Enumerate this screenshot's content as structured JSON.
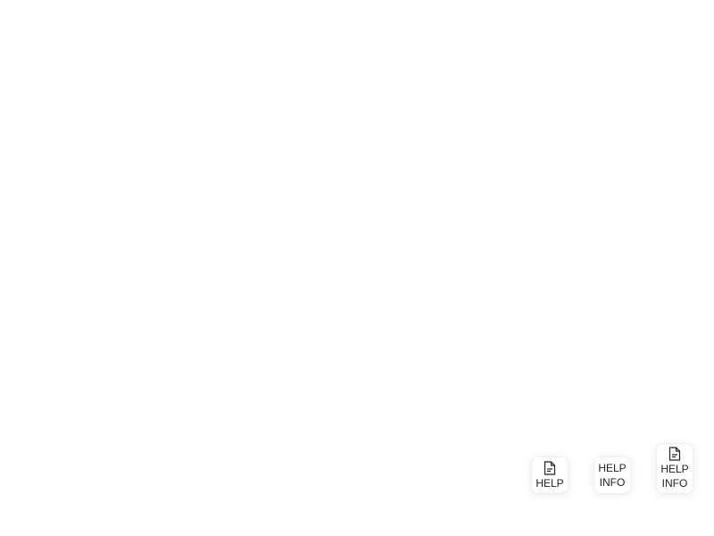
{
  "buttons": [
    {
      "icon": "document-icon",
      "line1": "HELP"
    },
    {
      "line1": "HELP",
      "line2": "INFO"
    },
    {
      "icon": "document-icon",
      "line1": "HELP",
      "line2": "INFO"
    }
  ]
}
